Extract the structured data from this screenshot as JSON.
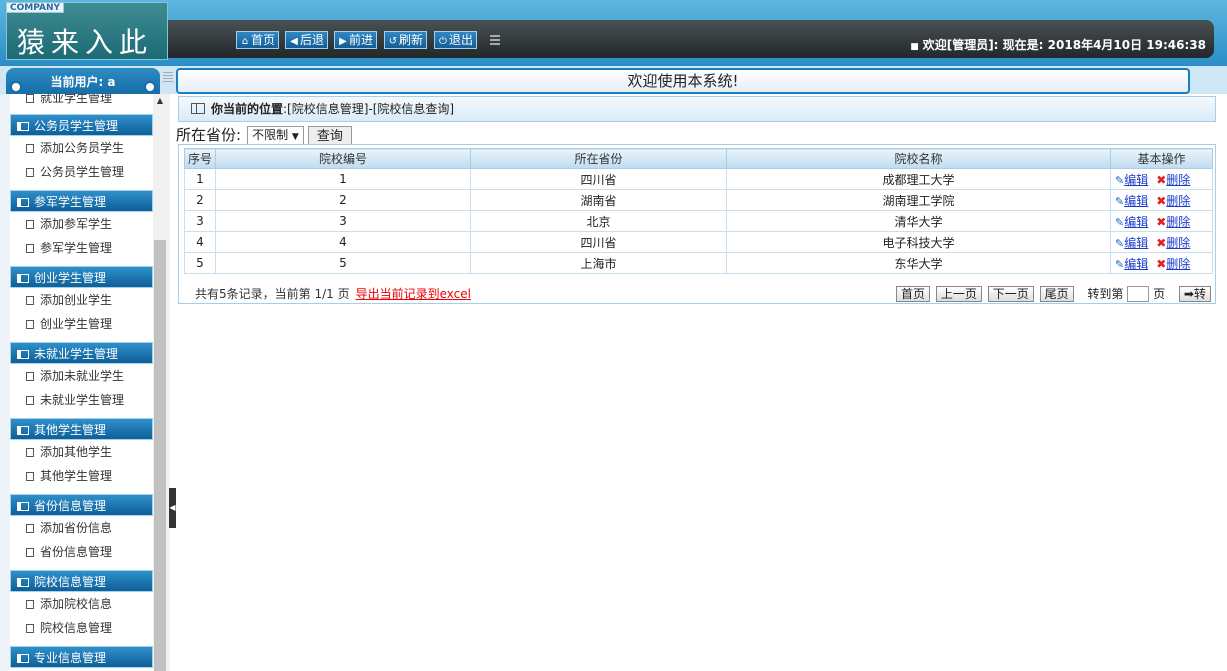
{
  "header": {
    "company_badge": "COMPANY",
    "logo_text": "猿来入此",
    "nav": [
      {
        "label": "首页",
        "icon": "home-icon"
      },
      {
        "label": "后退",
        "icon": "back-arrow-icon"
      },
      {
        "label": "前进",
        "icon": "forward-arrow-icon"
      },
      {
        "label": "刷新",
        "icon": "refresh-icon"
      },
      {
        "label": "退出",
        "icon": "power-icon"
      }
    ],
    "welcome_prefix": "欢迎[管理员]:",
    "time_prefix": "现在是:",
    "datetime": "2018年4月10日 19:46:38"
  },
  "subbar": {
    "current_user": "当前用户: a",
    "banner": "欢迎使用本系统!"
  },
  "sidebar": {
    "partial_item": "就业学生管理",
    "groups": [
      {
        "title": "公务员学生管理",
        "items": [
          "添加公务员学生",
          "公务员学生管理"
        ]
      },
      {
        "title": "参军学生管理",
        "items": [
          "添加参军学生",
          "参军学生管理"
        ]
      },
      {
        "title": "创业学生管理",
        "items": [
          "添加创业学生",
          "创业学生管理"
        ]
      },
      {
        "title": "未就业学生管理",
        "items": [
          "添加未就业学生",
          "未就业学生管理"
        ]
      },
      {
        "title": "其他学生管理",
        "items": [
          "添加其他学生",
          "其他学生管理"
        ]
      },
      {
        "title": "省份信息管理",
        "items": [
          "添加省份信息",
          "省份信息管理"
        ]
      },
      {
        "title": "院校信息管理",
        "items": [
          "添加院校信息",
          "院校信息管理"
        ]
      },
      {
        "title": "专业信息管理",
        "items": []
      }
    ]
  },
  "location": {
    "label": "你当前的位置",
    "path": ":[院校信息管理]-[院校信息查询]"
  },
  "filter": {
    "label": "所在省份:",
    "selected": "不限制",
    "query_button": "查询"
  },
  "table": {
    "headers": [
      "序号",
      "院校编号",
      "所在省份",
      "院校名称",
      "基本操作"
    ],
    "rows": [
      [
        "1",
        "1",
        "四川省",
        "成都理工大学"
      ],
      [
        "2",
        "2",
        "湖南省",
        "湖南理工学院"
      ],
      [
        "3",
        "3",
        "北京",
        "清华大学"
      ],
      [
        "4",
        "4",
        "四川省",
        "电子科技大学"
      ],
      [
        "5",
        "5",
        "上海市",
        "东华大学"
      ]
    ],
    "edit_label": "编辑",
    "delete_label": "删除"
  },
  "footer": {
    "summary": "共有5条记录，当前第 1/1 页",
    "export_link": "导出当前记录到excel",
    "pager": {
      "first": "首页",
      "prev": "上一页",
      "next": "下一页",
      "last": "尾页",
      "goto_prefix": "转到第",
      "goto_suffix": "页",
      "go_button": "转"
    }
  }
}
